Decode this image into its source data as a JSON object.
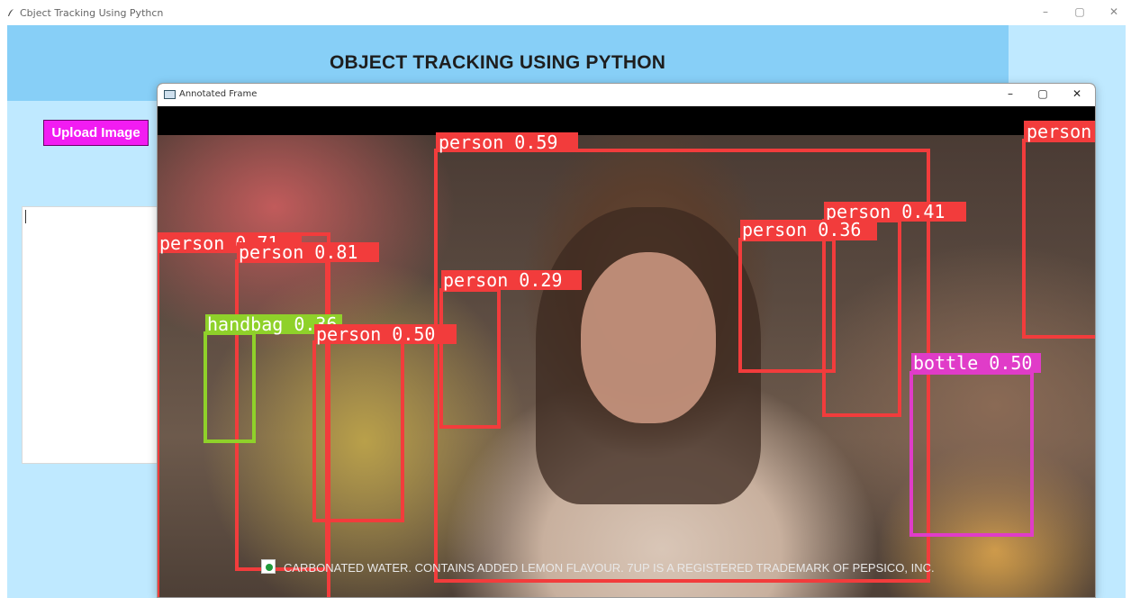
{
  "main_window": {
    "title": "Cbject Tracking Using Pythcn",
    "controls": {
      "minimize": "–",
      "maximize": "▢",
      "close": "✕"
    }
  },
  "app": {
    "heading": "OBJECT TRACKING USING PYTHON",
    "upload_button": "Upload Image",
    "text_area_value": ""
  },
  "frame_window": {
    "title": "Annotated Frame",
    "controls": {
      "minimize": "–",
      "maximize": "▢",
      "close": "✕"
    }
  },
  "detections": [
    {
      "label": "person 0.59",
      "color": "#f23c3c"
    },
    {
      "label": "person",
      "color": "#f23c3c"
    },
    {
      "label": "person 0.41",
      "color": "#f23c3c"
    },
    {
      "label": "person 0.36",
      "color": "#f23c3c"
    },
    {
      "label": "person 0.71",
      "color": "#f23c3c"
    },
    {
      "label": "person 0.81",
      "color": "#f23c3c"
    },
    {
      "label": "person 0.29",
      "color": "#f23c3c"
    },
    {
      "label": "handbag 0.36",
      "color": "#8fd12a"
    },
    {
      "label": "person 0.50",
      "color": "#f23c3c"
    },
    {
      "label": "bottle 0.50",
      "color": "#e03cc8"
    }
  ],
  "video_caption": "CARBONATED WATER. CONTAINS ADDED LEMON FLAVOUR. 7UP IS A REGISTERED TRADEMARK OF PEPSICO, INC.",
  "icons": {
    "app_icon": "feather-icon",
    "frame_icon": "image-window-icon"
  }
}
